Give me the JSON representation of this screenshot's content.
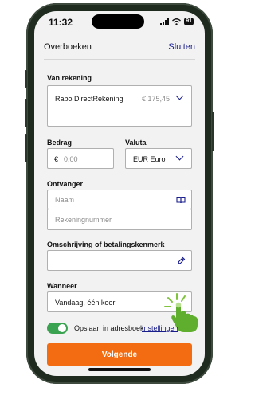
{
  "status_bar": {
    "time": "11:32",
    "battery": "91"
  },
  "nav": {
    "title": "Overboeken",
    "close_label": "Sluiten"
  },
  "from_account": {
    "label": "Van rekening",
    "name": "Rabo DirectRekening",
    "balance": "€ 175,45"
  },
  "amount": {
    "label": "Bedrag",
    "currency_symbol": "€",
    "placeholder": "0,00"
  },
  "currency": {
    "label": "Valuta",
    "value": "EUR Euro"
  },
  "recipient": {
    "label": "Ontvanger",
    "name_placeholder": "Naam",
    "account_placeholder": "Rekeningnummer"
  },
  "description": {
    "label": "Omschrijving of betalingskenmerk"
  },
  "when": {
    "label": "Wanneer",
    "value": "Vandaag, één keer"
  },
  "save": {
    "label": "Opslaan in adresboek",
    "enabled": true,
    "settings_link": "Instellingen"
  },
  "submit": {
    "label": "Volgende"
  },
  "colors": {
    "accent": "#f36c12",
    "link": "#1a1e8c",
    "toggle_on": "#3aa351",
    "tap_hint": "#7fc43c"
  },
  "icons": [
    "signal-icon",
    "wifi-icon",
    "battery-icon",
    "chevron-down-icon",
    "address-book-icon",
    "pencil-icon",
    "tap-hand-icon"
  ]
}
